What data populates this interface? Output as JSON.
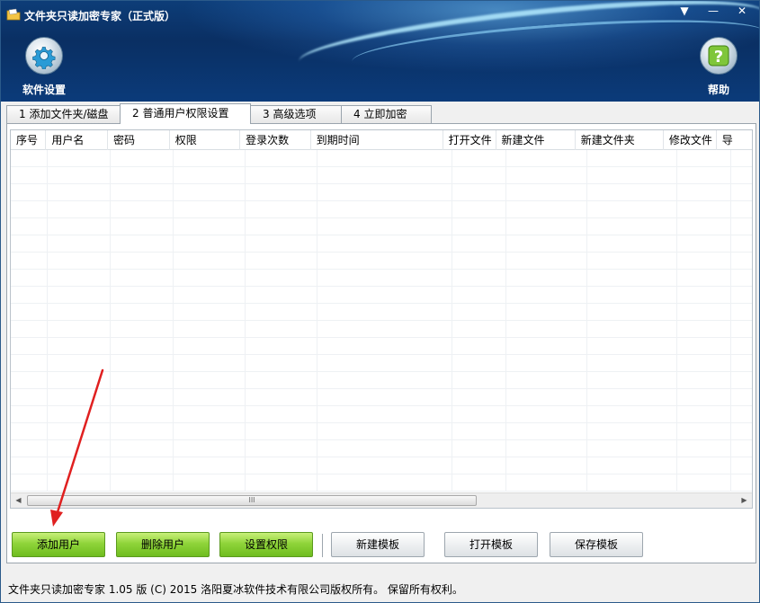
{
  "window": {
    "title": "文件夹只读加密专家（正式版）",
    "controls": {
      "menu": "▼",
      "minimize": "—",
      "close": "✕"
    }
  },
  "toolbar": {
    "settings_label": "软件设置",
    "help_label": "帮助"
  },
  "tabs": [
    {
      "label": "1 添加文件夹/磁盘"
    },
    {
      "label": "2 普通用户权限设置",
      "active": true
    },
    {
      "label": "3 高级选项"
    },
    {
      "label": "4 立即加密"
    }
  ],
  "grid": {
    "columns": [
      "序号",
      "用户名",
      "密码",
      "权限",
      "登录次数",
      "到期时间",
      "打开文件",
      "新建文件",
      "新建文件夹",
      "修改文件",
      "导"
    ],
    "scroll_thumb": "III"
  },
  "buttons": {
    "add_user": "添加用户",
    "delete_user": "删除用户",
    "set_permission": "设置权限",
    "new_template": "新建模板",
    "open_template": "打开模板",
    "save_template": "保存模板"
  },
  "status": "文件夹只读加密专家 1.05 版 (C) 2015 洛阳夏冰软件技术有限公司版权所有。 保留所有权利。",
  "colors": {
    "header_bg": "#0b3b7a",
    "button_green": "#8fd43a",
    "annotation_arrow": "#e02020"
  }
}
